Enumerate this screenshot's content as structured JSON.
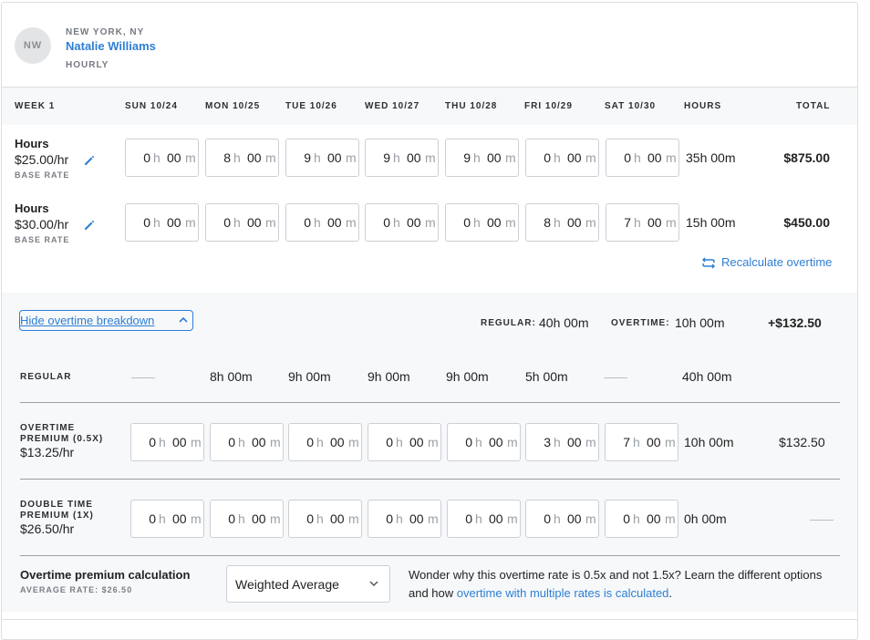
{
  "employee": {
    "initials": "NW",
    "location": "NEW YORK, NY",
    "name": "Natalie Williams",
    "pay_type": "HOURLY"
  },
  "columns": {
    "week": "WEEK 1",
    "days": [
      "SUN 10/24",
      "MON 10/25",
      "TUE 10/26",
      "WED 10/27",
      "THU 10/28",
      "FRI 10/29",
      "SAT 10/30"
    ],
    "hours": "HOURS",
    "total": "TOTAL"
  },
  "units": {
    "h": "h",
    "m": "m"
  },
  "rows": [
    {
      "title": "Hours",
      "rate": "$25.00/hr",
      "sub": "BASE RATE",
      "entries": [
        [
          "0",
          "00"
        ],
        [
          "8",
          "00"
        ],
        [
          "9",
          "00"
        ],
        [
          "9",
          "00"
        ],
        [
          "9",
          "00"
        ],
        [
          "0",
          "00"
        ],
        [
          "0",
          "00"
        ]
      ],
      "hours": "35h 00m",
      "total": "$875.00"
    },
    {
      "title": "Hours",
      "rate": "$30.00/hr",
      "sub": "BASE RATE",
      "entries": [
        [
          "0",
          "00"
        ],
        [
          "0",
          "00"
        ],
        [
          "0",
          "00"
        ],
        [
          "0",
          "00"
        ],
        [
          "0",
          "00"
        ],
        [
          "8",
          "00"
        ],
        [
          "7",
          "00"
        ]
      ],
      "hours": "15h 00m",
      "total": "$450.00"
    }
  ],
  "recalculate_label": "Recalculate overtime",
  "overtime": {
    "toggle_label": "Hide overtime breakdown",
    "summary": {
      "regular_label": "REGULAR:",
      "regular_value": "40h 00m",
      "overtime_label": "OVERTIME:",
      "overtime_value": "10h 00m",
      "total": "+$132.50"
    },
    "regular": {
      "label": "REGULAR",
      "cells": [
        "——",
        "8h 00m",
        "9h 00m",
        "9h 00m",
        "9h 00m",
        "5h 00m",
        "——"
      ],
      "hours": "40h 00m"
    },
    "premium": {
      "label_line1": "OVERTIME",
      "label_line2": "PREMIUM (0.5X)",
      "rate": "$13.25/hr",
      "entries": [
        [
          "0",
          "00"
        ],
        [
          "0",
          "00"
        ],
        [
          "0",
          "00"
        ],
        [
          "0",
          "00"
        ],
        [
          "0",
          "00"
        ],
        [
          "3",
          "00"
        ],
        [
          "7",
          "00"
        ]
      ],
      "hours": "10h 00m",
      "total": "$132.50"
    },
    "double": {
      "label_line1": "DOUBLE TIME",
      "label_line2": "PREMIUM (1X)",
      "rate": "$26.50/hr",
      "entries": [
        [
          "0",
          "00"
        ],
        [
          "0",
          "00"
        ],
        [
          "0",
          "00"
        ],
        [
          "0",
          "00"
        ],
        [
          "0",
          "00"
        ],
        [
          "0",
          "00"
        ],
        [
          "0",
          "00"
        ]
      ],
      "hours": "0h 00m",
      "total": "——"
    },
    "calculation": {
      "title": "Overtime premium calculation",
      "average": "AVERAGE RATE: $26.50",
      "selected": "Weighted Average",
      "explain_text": "Wonder why this overtime rate is 0.5x and not 1.5x? Learn the different options and how ",
      "explain_link": "overtime with multiple rates is calculated",
      "explain_end": "."
    }
  },
  "colors": {
    "accent": "#2e7fd4",
    "panel_bg": "#f6f8fa",
    "border": "#ccd0d5"
  }
}
